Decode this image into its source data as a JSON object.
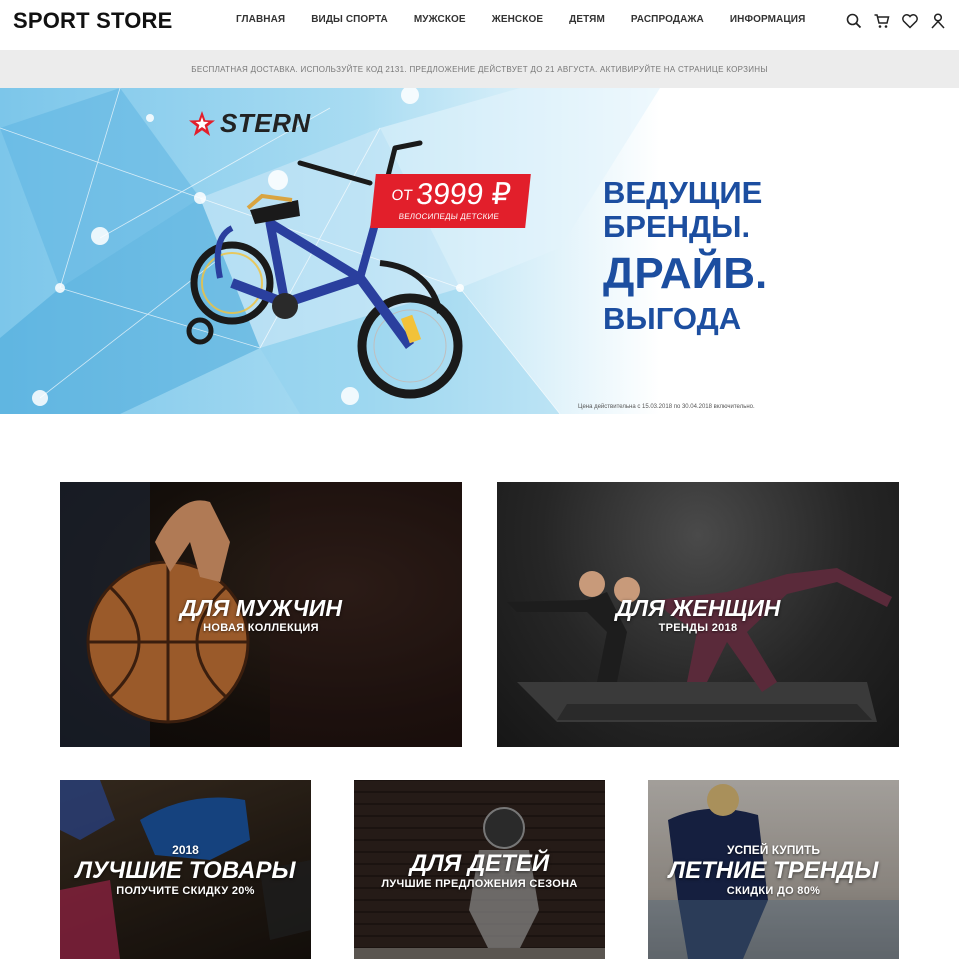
{
  "header": {
    "logo": "SPORT STORE",
    "nav": [
      "ГЛАВНАЯ",
      "ВИДЫ СПОРТА",
      "МУЖСКОЕ",
      "ЖЕНСКОЕ",
      "ДЕТЯМ",
      "РАСПРОДАЖА",
      "ИНФОРМАЦИЯ"
    ],
    "icons": [
      "search-icon",
      "cart-icon",
      "heart-icon",
      "user-icon"
    ]
  },
  "promo": {
    "text": "БЕСПЛАТНАЯ ДОСТАВКА. ИСПОЛЬЗУЙТЕ КОД 2131. ПРЕДЛОЖЕНИЕ ДЕЙСТВУЕТ ДО 21 АВГУСТА. АКТИВИРУЙТЕ НА СТРАНИЦЕ КОРЗИНЫ"
  },
  "hero": {
    "brand": "STERN",
    "price_prefix": "ОТ",
    "price": "3999 ₽",
    "price_caption": "ВЕЛОСИПЕДЫ ДЕТСКИЕ",
    "slogan": [
      "ВЕДУЩИЕ",
      "БРЕНДЫ.",
      "ДРАЙВ.",
      "ВЫГОДА"
    ],
    "disclaimer": "Цена действительна с 15.03.2018 по 30.04.2018 включительно.",
    "accent": "#e21f2b",
    "slogan_color": "#1c4ea0"
  },
  "tiles": {
    "men": {
      "title": "ДЛЯ МУЖЧИН",
      "subtitle": "НОВАЯ КОЛЛЕКЦИЯ"
    },
    "women": {
      "title": "ДЛЯ ЖЕНЩИН",
      "subtitle": "ТРЕНДЫ 2018"
    },
    "best": {
      "pre": "2018",
      "title": "ЛУЧШИЕ ТОВАРЫ",
      "subtitle": "ПОЛУЧИТЕ СКИДКУ 20%"
    },
    "kids": {
      "title": "ДЛЯ ДЕТЕЙ",
      "subtitle": "ЛУЧШИЕ ПРЕДЛОЖЕНИЯ СЕЗОНА"
    },
    "summer": {
      "pre": "УСПЕЙ КУПИТЬ",
      "title": "ЛЕТНИЕ ТРЕНДЫ",
      "subtitle": "СКИДКИ ДО 80%"
    }
  }
}
